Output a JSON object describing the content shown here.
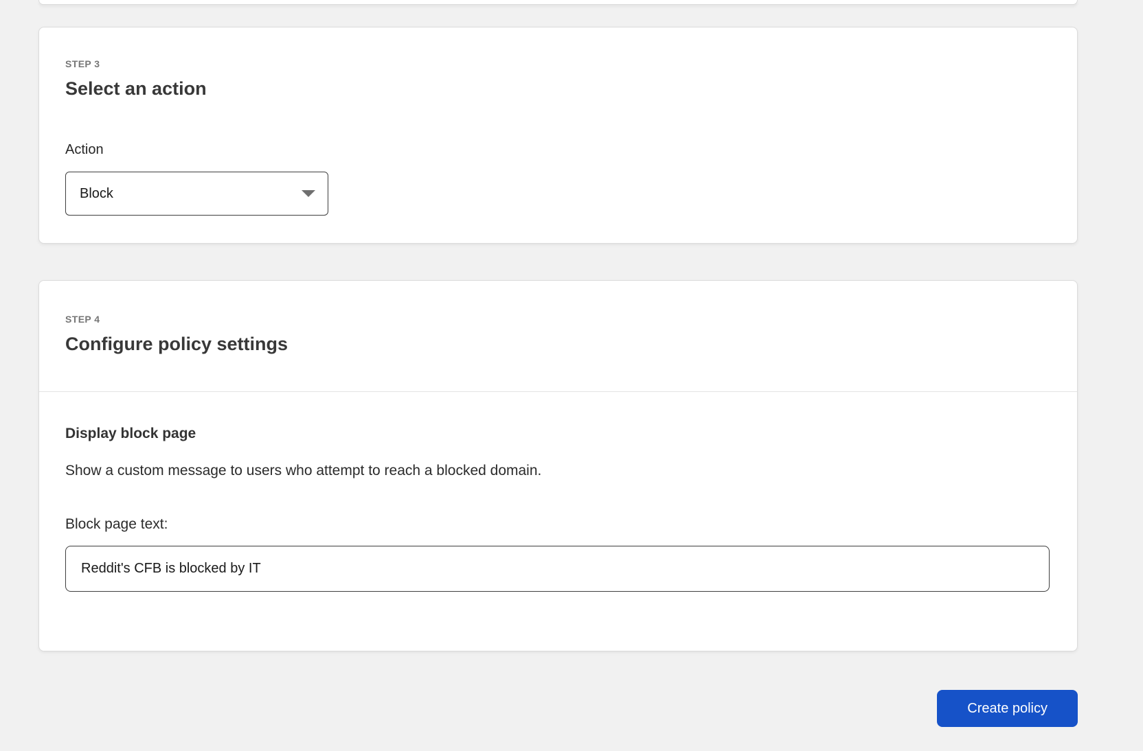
{
  "colors": {
    "page_background": "#f1f1f1",
    "card_background": "#ffffff",
    "accent_blue": "#1652c8",
    "step_label_gray": "#767676",
    "heading_dark": "#383838",
    "input_border": "#3e3e3e"
  },
  "step3_card": {
    "step_label": "STEP 3",
    "title": "Select an action",
    "action_field": {
      "label": "Action",
      "selected_value": "Block"
    }
  },
  "step4_card": {
    "step_label": "STEP 4",
    "title": "Configure policy settings",
    "block_page_section": {
      "heading": "Display block page",
      "description": "Show a custom message to users who attempt to reach a blocked domain.",
      "input_label": "Block page text:",
      "input_value": "Reddit's CFB is blocked by IT"
    }
  },
  "footer": {
    "create_button_label": "Create policy"
  },
  "icons": {
    "action_dropdown": "caret-down-icon"
  }
}
